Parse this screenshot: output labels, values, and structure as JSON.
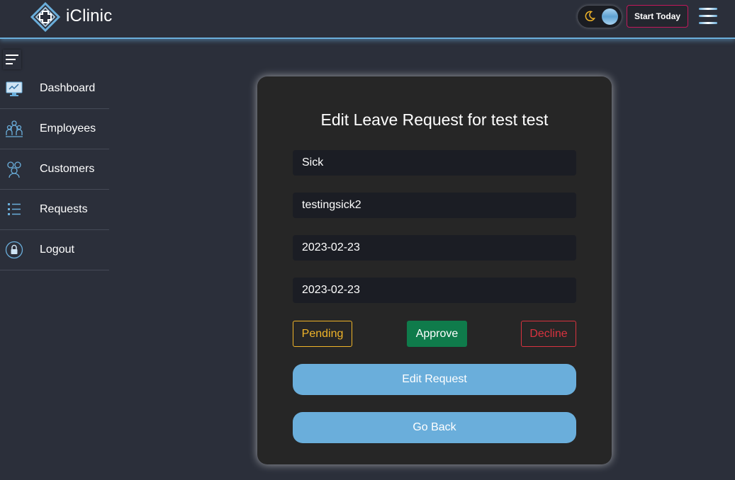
{
  "app": {
    "name": "iClinic"
  },
  "header": {
    "theme_toggle_icon": "moon-icon",
    "start_label": "Start Today",
    "menu_icon": "hamburger-menu-icon"
  },
  "sidebar": {
    "items": [
      {
        "label": "Dashboard",
        "icon": "dashboard-monitor-icon"
      },
      {
        "label": "Employees",
        "icon": "employees-group-icon"
      },
      {
        "label": "Customers",
        "icon": "customers-people-icon"
      },
      {
        "label": "Requests",
        "icon": "list-icon"
      },
      {
        "label": "Logout",
        "icon": "lock-icon"
      }
    ]
  },
  "form": {
    "title": "Edit Leave Request for test test",
    "fields": {
      "type": "Sick",
      "reason": "testingsick2",
      "start_date": "2023-02-23",
      "end_date": "2023-02-23"
    },
    "status_buttons": {
      "pending": "Pending",
      "approve": "Approve",
      "decline": "Decline"
    },
    "edit_label": "Edit Request",
    "back_label": "Go Back"
  },
  "colors": {
    "background": "#2b2f3a",
    "accent": "#6aaedb",
    "card": "#262626",
    "pending": "#f0b429",
    "approve": "#0f7b4b",
    "decline": "#d9333f",
    "start_border": "#c2185b"
  }
}
